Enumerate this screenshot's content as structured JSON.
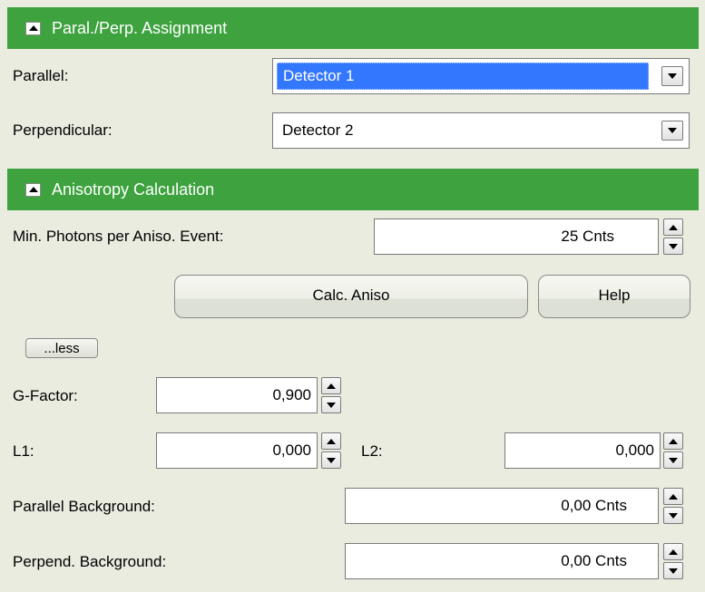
{
  "assignment": {
    "header": "Paral./Perp. Assignment",
    "parallel_label": "Parallel:",
    "parallel_value": "Detector 1",
    "perpendicular_label": "Perpendicular:",
    "perpendicular_value": "Detector 2"
  },
  "anisotropy": {
    "header": "Anisotropy Calculation",
    "min_photons_label": "Min. Photons per Aniso. Event:",
    "min_photons_value": "25 Cnts",
    "calc_button": "Calc. Aniso",
    "help_button": "Help",
    "less_button": "...less",
    "g_factor_label": "G-Factor:",
    "g_factor_value": "0,900",
    "l1_label": "L1:",
    "l1_value": "0,000",
    "l2_label": "L2:",
    "l2_value": "0,000",
    "parallel_bg_label": "Parallel Background:",
    "parallel_bg_value": "0,00 Cnts",
    "perpend_bg_label": "Perpend. Background:",
    "perpend_bg_value": "0,00 Cnts"
  },
  "colors": {
    "header_green": "#3ea23f",
    "panel_bg": "#e9ecdf",
    "selection_blue": "#3377ff"
  },
  "icons": {
    "section_toggle": "collapse-triangle-icon",
    "dropdown": "chevron-down-icon",
    "spin_up": "spin-up-icon",
    "spin_down": "spin-down-icon"
  }
}
